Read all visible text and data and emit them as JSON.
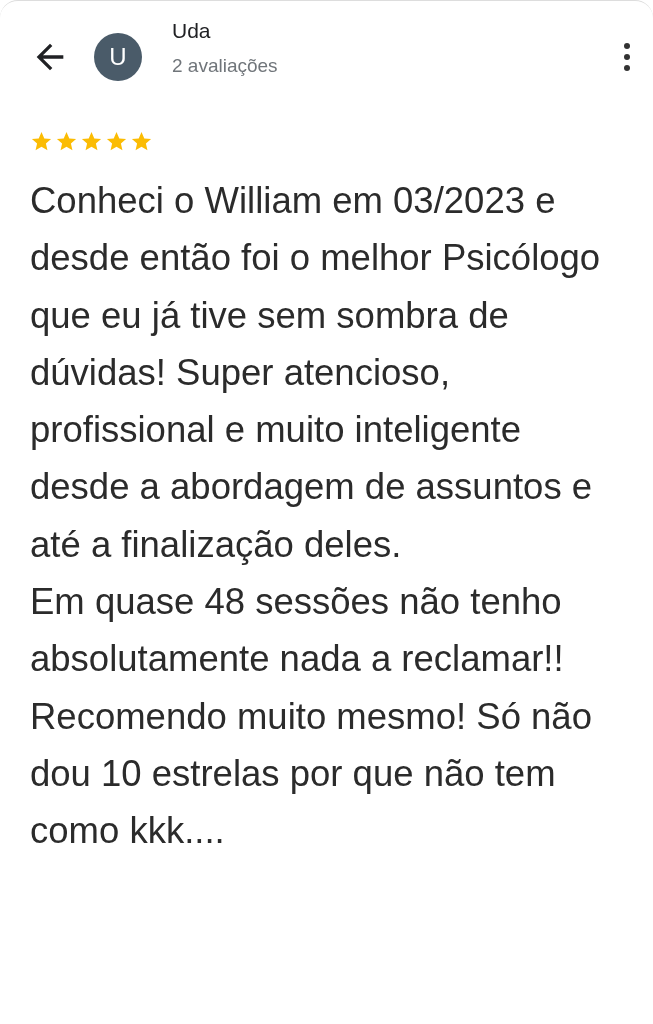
{
  "reviewer": {
    "initial": "U",
    "name": "Uda",
    "review_count": "2 avaliações"
  },
  "review": {
    "stars": 5,
    "text": "Conheci o William em 03/2023 e desde então foi o melhor Psicólogo que eu já tive sem sombra de dúvidas! Super atencioso, profissional e muito inteligente desde a abordagem de assuntos e até a finalização deles.\nEm quase 48 sessões não tenho absolutamente nada a reclamar!!\nRecomendo muito mesmo! Só não dou 10 estrelas por que não tem como kkk...."
  }
}
